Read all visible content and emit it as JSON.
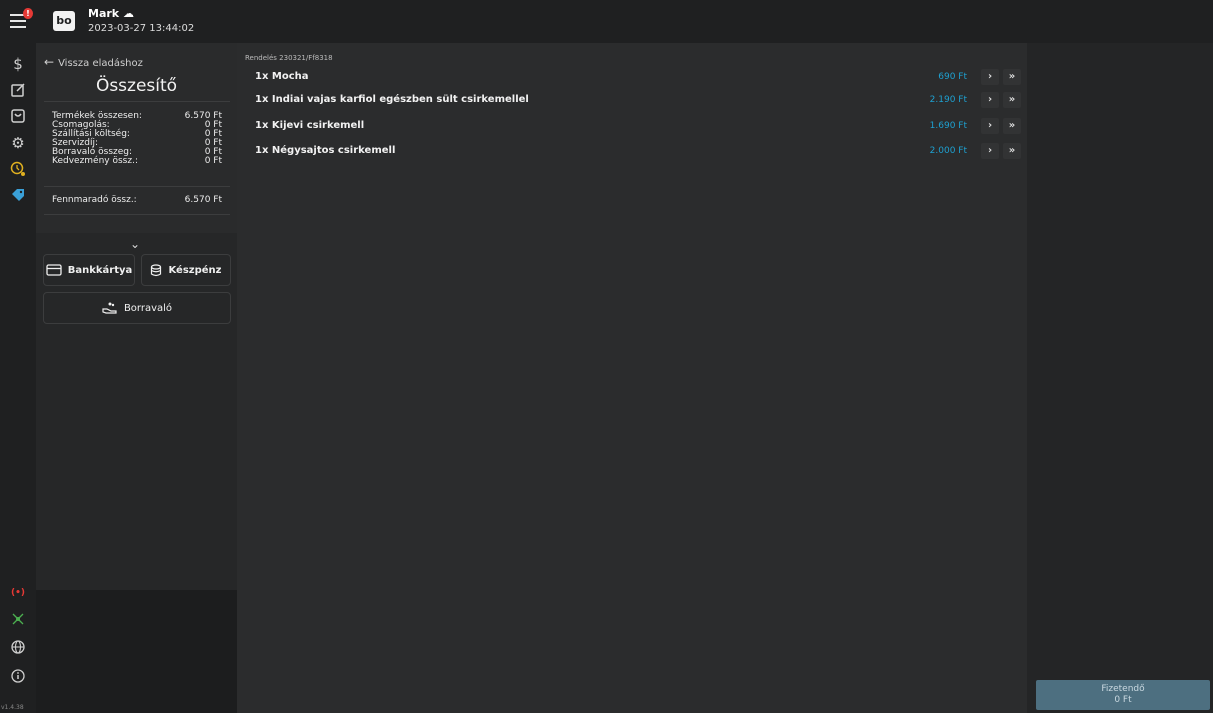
{
  "header": {
    "menu_badge": "!",
    "logo_text": "bo",
    "user_name": "Mark ☁",
    "datetime": "2023-03-27  13:44:02"
  },
  "rail": {
    "icons": [
      "dollar-icon",
      "edit-icon",
      "shopping-bag-icon",
      "gear-icon",
      "clock-alert-icon",
      "tag-icon",
      "signal-icon",
      "network-icon",
      "globe-icon",
      "info-icon"
    ],
    "version": "v1.4.38"
  },
  "summary": {
    "back_label": "Vissza eladáshoz",
    "title": "Összesítő",
    "rows": [
      {
        "label": "Termékek összesen:",
        "value": "6.570 Ft"
      },
      {
        "label": "Csomagolás:",
        "value": "0 Ft"
      },
      {
        "label": "Szállítási költség:",
        "value": "0 Ft"
      },
      {
        "label": "Szervizdíj:",
        "value": "0 Ft"
      },
      {
        "label": "Borravaló összeg:",
        "value": "0 Ft"
      },
      {
        "label": "Kedvezmény össz.:",
        "value": "0 Ft"
      }
    ],
    "remaining_label": "Fennmaradó össz.:",
    "remaining_value": "6.570 Ft"
  },
  "payment": {
    "card_label": "Bankkártya",
    "cash_label": "Készpénz",
    "tip_label": "Borravaló"
  },
  "order": {
    "number_label": "Rendelés  230321/Ff8318",
    "items": [
      {
        "name": "1x Mocha",
        "price": "690 Ft"
      },
      {
        "name": "1x Indiai vajas karfiol egészben sült csirkemellel",
        "price": "2.190 Ft"
      },
      {
        "name": "1x Kijevi csirkemell",
        "price": "1.690 Ft"
      },
      {
        "name": "1x Négysajtos csirkemell",
        "price": "2.000 Ft"
      }
    ],
    "move_one": "›",
    "move_all": "»"
  },
  "checkout": {
    "label": "Fizetendő",
    "amount": "0 Ft"
  },
  "colors": {
    "accent_price": "#1ea0d0",
    "pay_button": "#4d6f80",
    "badge": "#e53935"
  }
}
